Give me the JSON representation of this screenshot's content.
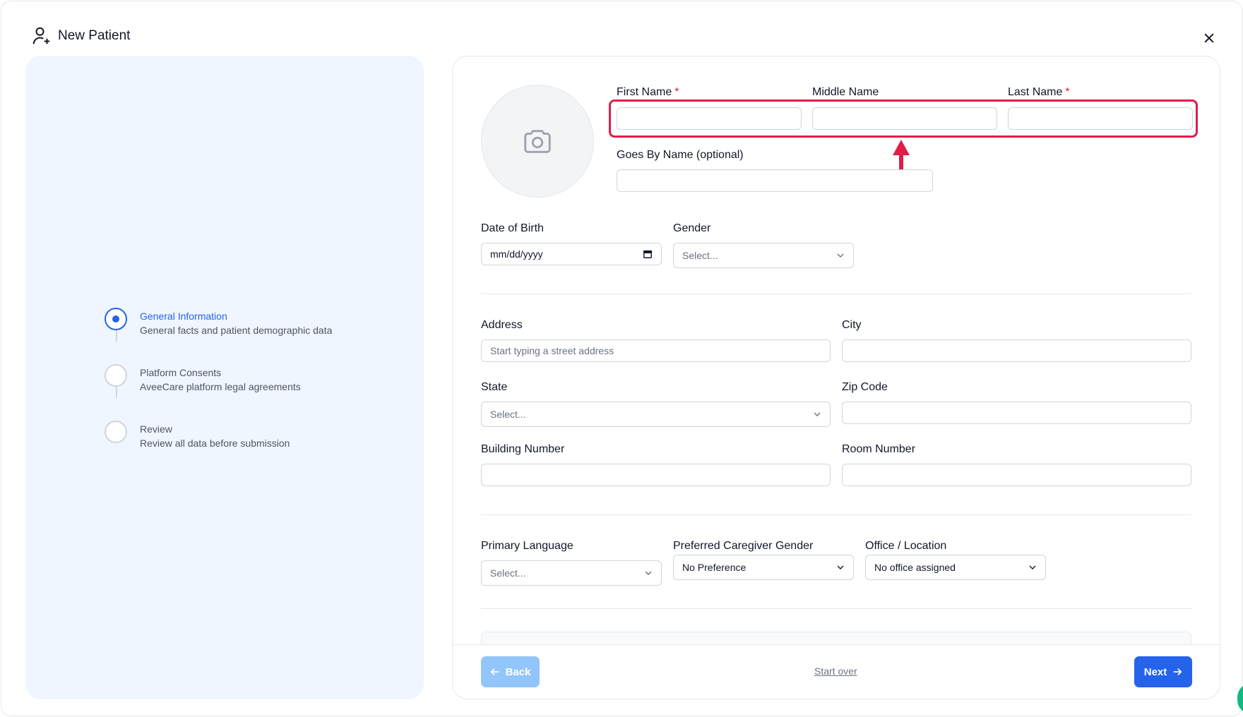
{
  "header": {
    "title": "New Patient"
  },
  "steps": [
    {
      "title": "General Information",
      "subtitle": "General facts and patient demographic data",
      "active": true
    },
    {
      "title": "Platform Consents",
      "subtitle": "AveeCare platform legal agreements",
      "active": false
    },
    {
      "title": "Review",
      "subtitle": "Review all data before submission",
      "active": false
    }
  ],
  "form": {
    "first_name": {
      "label": "First Name",
      "required": "*",
      "value": ""
    },
    "middle_name": {
      "label": "Middle Name",
      "value": ""
    },
    "last_name": {
      "label": "Last Name",
      "required": "*",
      "value": ""
    },
    "goes_by": {
      "label": "Goes By Name (optional)",
      "value": ""
    },
    "dob": {
      "label": "Date of Birth",
      "placeholder": "mm/dd/yyyy"
    },
    "gender": {
      "label": "Gender",
      "placeholder": "Select..."
    },
    "address": {
      "label": "Address",
      "placeholder": "Start typing a street address"
    },
    "city": {
      "label": "City",
      "value": ""
    },
    "state": {
      "label": "State",
      "placeholder": "Select..."
    },
    "zip": {
      "label": "Zip Code",
      "value": ""
    },
    "building": {
      "label": "Building Number",
      "value": ""
    },
    "room": {
      "label": "Room Number",
      "value": ""
    },
    "language": {
      "label": "Primary Language",
      "placeholder": "Select..."
    },
    "caregiver_gender": {
      "label": "Preferred Caregiver Gender",
      "value": "No Preference"
    },
    "office": {
      "label": "Office / Location",
      "value": "No office assigned"
    }
  },
  "footer": {
    "back_label": "Back",
    "start_over_label": "Start over",
    "next_label": "Next"
  },
  "colors": {
    "primary": "#2563eb",
    "highlight": "#e11d48",
    "panel_bg": "#eff6ff"
  }
}
